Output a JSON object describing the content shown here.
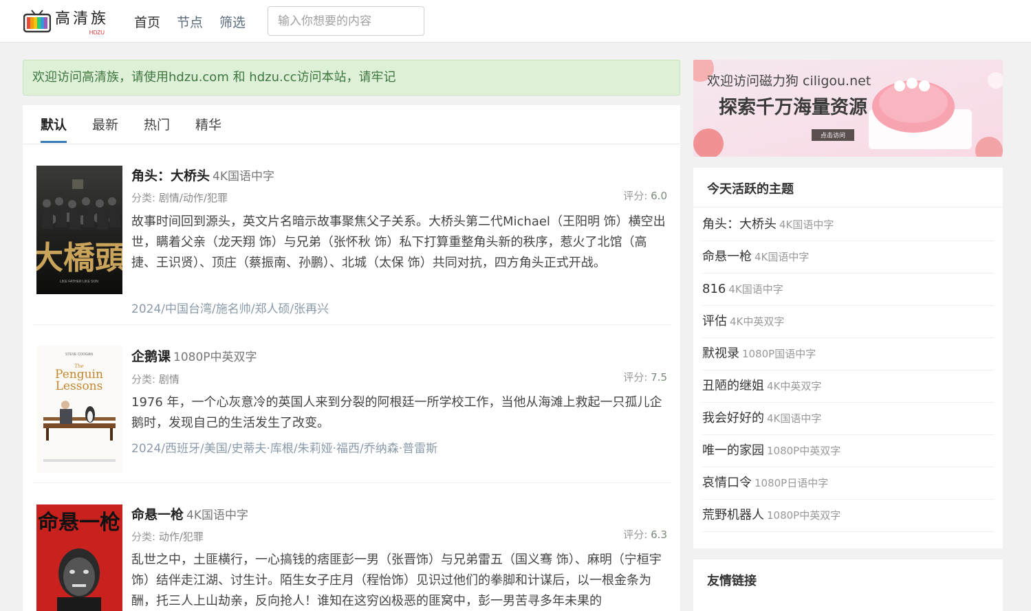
{
  "header": {
    "logo_text": "高清族",
    "logo_sub": "HDZU",
    "nav": [
      "首页",
      "节点",
      "筛选"
    ],
    "search_placeholder": "输入你想要的内容"
  },
  "notice": "欢迎访问高清族，请使用hdzu.com 和 hdzu.cc访问本站，请牢记",
  "tabs": [
    "默认",
    "最新",
    "热门",
    "精华"
  ],
  "posts": [
    {
      "title": "角头：大桥头",
      "quality": "4K国语中字",
      "category_label": "分类:",
      "category": "剧情/动作/犯罪",
      "score_label": "评分:",
      "score": "6.0",
      "description": "故事时间回到源头，英文片名暗示故事聚焦父子关系。大桥头第二代Michael（王阳明 饰）横空出世，瞒着父亲（龙天翔 饰）与兄弟（张怀秋 饰）私下打算重整角头新的秩序，惹火了北馆（高捷、王识贤）、顶庄（蔡振南、孙鹏）、北城（太保 饰）共同对抗，四方角头正式开战。",
      "meta": "2024/中国台湾/施名帅/郑人硕/张再兴",
      "poster_text": "大橋頭",
      "poster_sub": "LIKE FATHER LIKE SON"
    },
    {
      "title": "企鹅课",
      "quality": "1080P中英双字",
      "category_label": "分类:",
      "category": "剧情",
      "score_label": "评分:",
      "score": "7.5",
      "description": "1976 年，一个心灰意冷的英国人来到分裂的阿根廷一所学校工作，当他从海滩上救起一只孤儿企鹅时，发现自己的生活发生了改变。",
      "meta": "2024/西班牙/美国/史蒂夫·库根/朱莉娅·福西/乔纳森·普雷斯",
      "poster_text": "The Penguin Lessons",
      "poster_sub": "STEVE COOGAN"
    },
    {
      "title": "命悬一枪",
      "quality": "4K国语中字",
      "category_label": "分类:",
      "category": "动作/犯罪",
      "score_label": "评分:",
      "score": "6.3",
      "description": "乱世之中，土匪横行，一心搞钱的痞匪彭一男（张晋饰）与兄弟雷五（国义骞 饰）、麻明（宁桓宇 饰）结伴走江湖、讨生计。陌生女子庄月（程怡饰）见识过他们的拳脚和计谋后，以一根金条为酬，托三人上山劫亲，反向抢人！谁知在这穷凶极恶的匪窝中，彭一男苦寻多年未果的",
      "meta": "",
      "poster_text": "命悬一枪"
    }
  ],
  "ad": {
    "line1": "欢迎访问磁力狗 ciligou.net",
    "line2": "探索千万海量资源",
    "button": "点击访问"
  },
  "sidebar": {
    "title": "今天活跃的主题",
    "topics": [
      {
        "title": "角头：大桥头",
        "quality": "4K国语中字"
      },
      {
        "title": "命悬一枪",
        "quality": "4K国语中字"
      },
      {
        "title": "816",
        "quality": "4K国语中字"
      },
      {
        "title": "评估",
        "quality": "4K中英双字"
      },
      {
        "title": "默视录",
        "quality": "1080P国语中字"
      },
      {
        "title": "丑陋的继姐",
        "quality": "4K中英双字"
      },
      {
        "title": "我会好好的",
        "quality": "4K国语中字"
      },
      {
        "title": "唯一的家园",
        "quality": "1080P中英双字"
      },
      {
        "title": "哀情口令",
        "quality": "1080P日语中字"
      },
      {
        "title": "荒野机器人",
        "quality": "1080P中英双字"
      }
    ]
  },
  "links": {
    "title": "友情链接"
  }
}
